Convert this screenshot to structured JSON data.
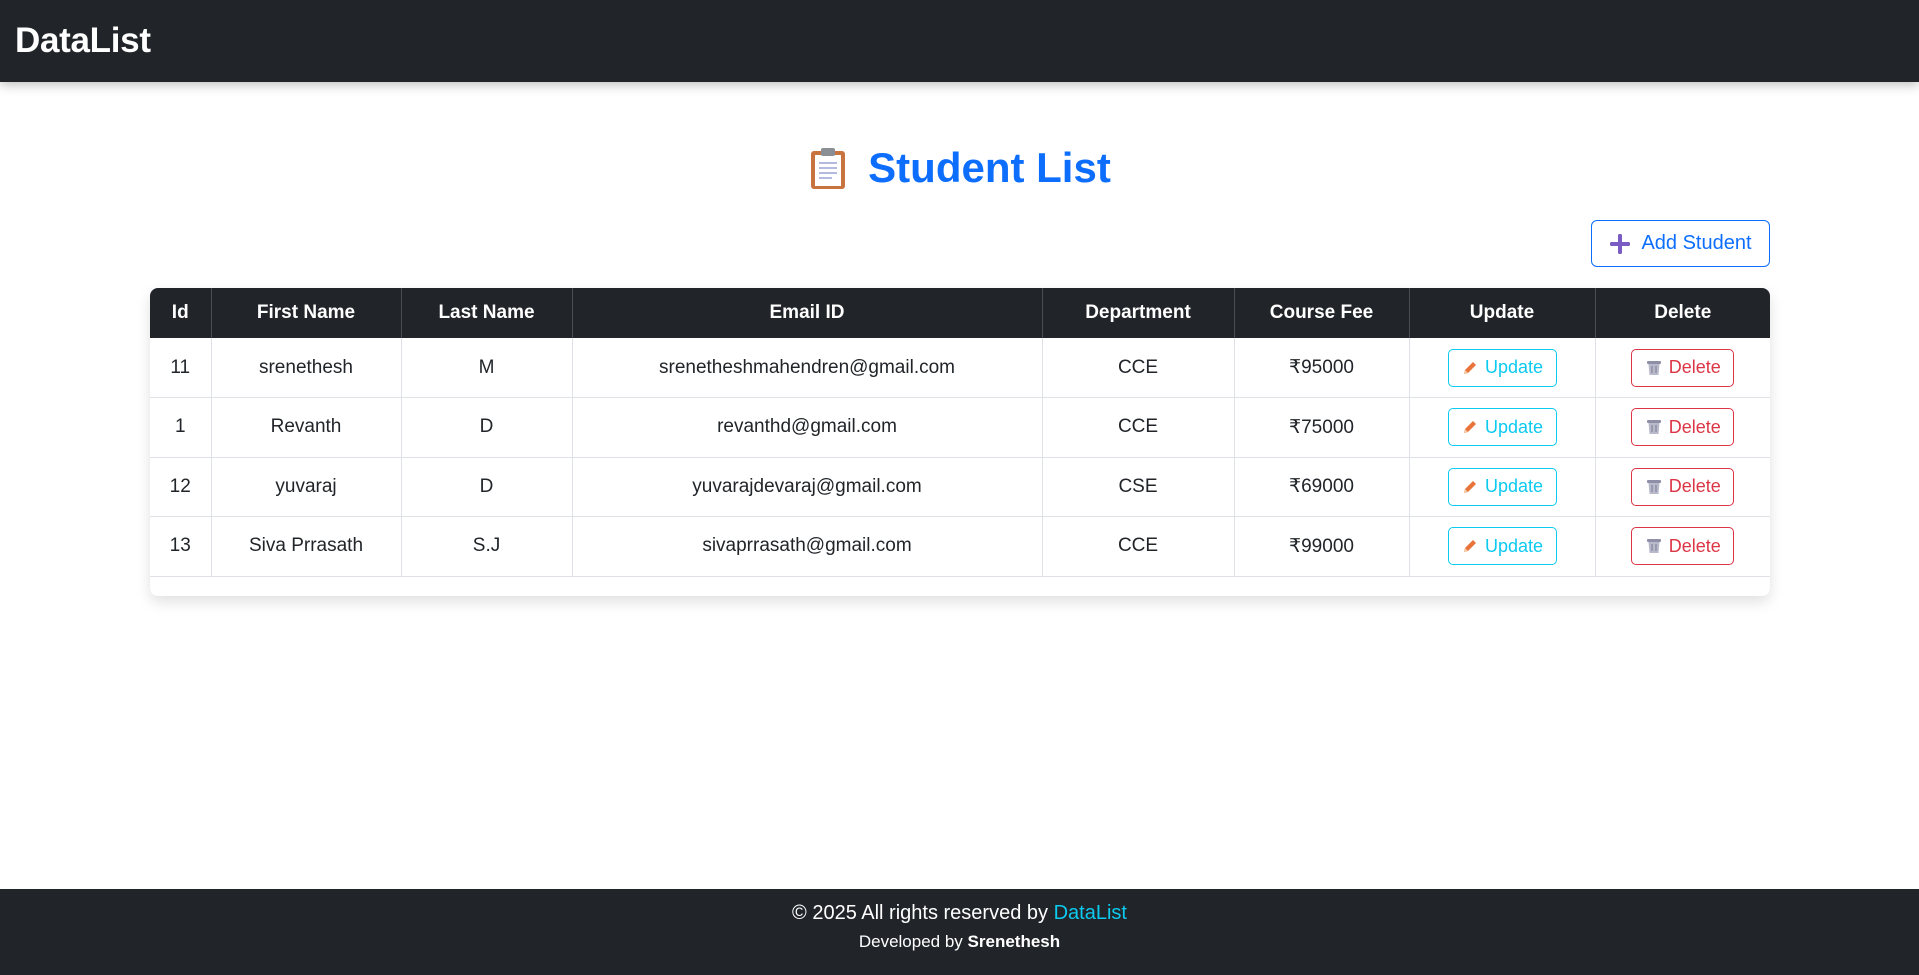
{
  "navbar": {
    "brand": "DataList"
  },
  "page": {
    "title": "Student List",
    "title_icon": "clipboard-icon"
  },
  "actions": {
    "add_label": "Add Student",
    "add_icon": "plus-icon"
  },
  "table": {
    "columns": [
      "Id",
      "First Name",
      "Last Name",
      "Email ID",
      "Department",
      "Course Fee",
      "Update",
      "Delete"
    ],
    "rows": [
      {
        "id": "11",
        "first_name": "srenethesh",
        "last_name": "M",
        "email": "srenetheshmahendren@gmail.com",
        "department": "CCE",
        "fee": "₹95000"
      },
      {
        "id": "1",
        "first_name": "Revanth",
        "last_name": "D",
        "email": "revanthd@gmail.com",
        "department": "CCE",
        "fee": "₹75000"
      },
      {
        "id": "12",
        "first_name": "yuvaraj",
        "last_name": "D",
        "email": "yuvarajdevaraj@gmail.com",
        "department": "CSE",
        "fee": "₹69000"
      },
      {
        "id": "13",
        "first_name": "Siva Prrasath",
        "last_name": "S.J",
        "email": "sivaprrasath@gmail.com",
        "department": "CCE",
        "fee": "₹99000"
      }
    ],
    "update_label": "Update",
    "delete_label": "Delete",
    "update_icon": "pencil-icon",
    "delete_icon": "trash-icon"
  },
  "footer": {
    "copyright_prefix": "© 2025 All rights reserved by",
    "brand": "DataList",
    "developed_prefix": "Developed by",
    "developer": "Srenethesh"
  },
  "colors": {
    "navbar_bg": "#212529",
    "primary": "#0d6efd",
    "info": "#0dcaf0",
    "danger": "#dc3545"
  }
}
